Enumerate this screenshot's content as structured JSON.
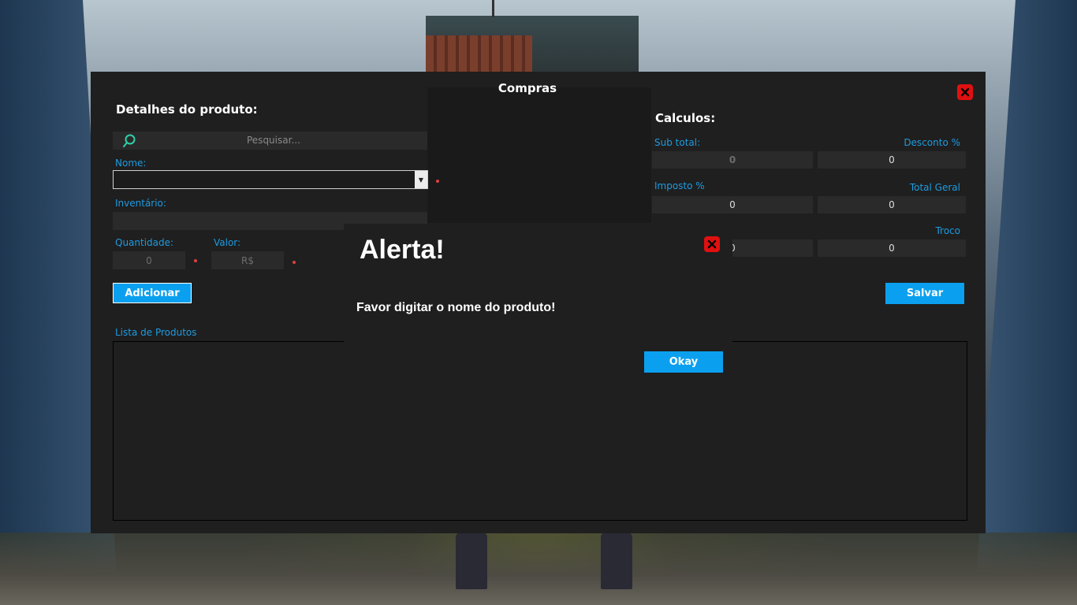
{
  "window": {
    "title": "Compras"
  },
  "product": {
    "section_title": "Detalhes do produto:",
    "search_placeholder": "Pesquisar...",
    "name_label": "Nome:",
    "name_value": "",
    "inventory_label": "Inventário:",
    "inventory_value": "",
    "quantity_label": "Quantidade:",
    "quantity_value": "0",
    "value_label": "Valor:",
    "value_value": "R$",
    "add_button": "Adicionar",
    "list_label": "Lista de Produtos"
  },
  "calc": {
    "section_title": "Calculos:",
    "subtotal_label": "Sub total:",
    "subtotal_value": "0",
    "discount_label": "Desconto %",
    "discount_value": "0",
    "tax_label": "Imposto %",
    "tax_value": "0",
    "total_label": "Total Geral",
    "total_value": "0",
    "paid_value": "0",
    "change_label": "Troco",
    "change_value": "0",
    "save_button": "Salvar"
  },
  "alert": {
    "title": "Alerta!",
    "message": "Favor digitar o nome do produto!",
    "ok_button": "Okay"
  },
  "colors": {
    "accent": "#0ba0ef",
    "close": "#e01010",
    "panel": "#1f1f1f",
    "field": "#2a2a2a",
    "required": "#e0403a"
  }
}
